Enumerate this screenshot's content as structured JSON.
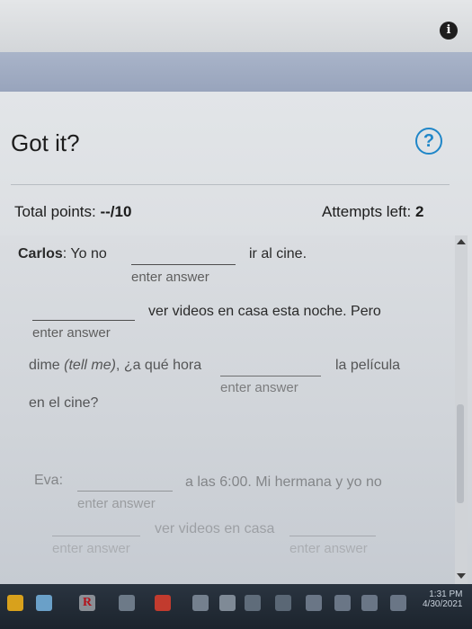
{
  "header": {
    "title": "Got it?",
    "info_icon": "info-icon",
    "help_icon": "help-icon"
  },
  "score": {
    "total_label": "Total points: ",
    "total_value": "--/10",
    "attempts_label": "Attempts left: ",
    "attempts_value": "2"
  },
  "exercise": {
    "placeholder": "enter answer",
    "carlos_speaker": "Carlos",
    "carlos_colon": ": Yo no",
    "carlos_after_1": "ir al cine.",
    "carlos_after_2": "ver videos en casa esta noche. Pero",
    "carlos_line3_pre": "dime",
    "carlos_line3_italic": "(tell me)",
    "carlos_line3_post": ", ¿a qué hora",
    "carlos_after_3": "la película",
    "carlos_line4": "en el cine?",
    "eva_speaker": "Eva:",
    "eva_after_1": "a las 6:00. Mi hermana y yo no",
    "eva_after_2": "ver videos en casa"
  },
  "taskbar": {
    "time": "1:31 PM",
    "date": "4/30/2021"
  },
  "colors": {
    "accent": "#1f86c8",
    "taskbar": "#1c242d",
    "header_band": "#98a4bc"
  }
}
